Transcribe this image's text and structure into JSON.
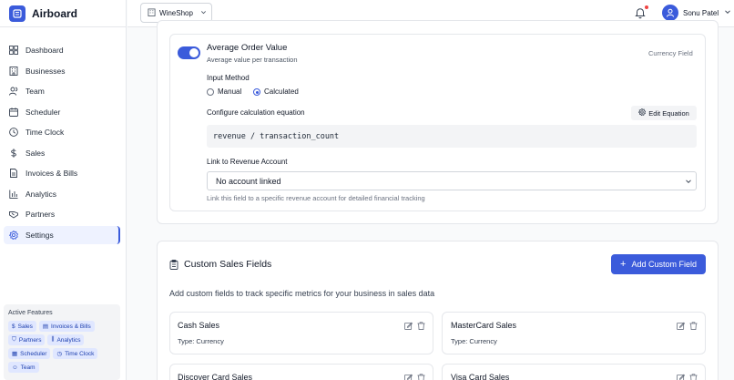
{
  "app": {
    "name": "Airboard"
  },
  "sidebar": {
    "items": [
      {
        "label": "Dashboard",
        "icon": "dashboard-icon"
      },
      {
        "label": "Businesses",
        "icon": "building-icon"
      },
      {
        "label": "Team",
        "icon": "users-icon"
      },
      {
        "label": "Scheduler",
        "icon": "calendar-icon"
      },
      {
        "label": "Time Clock",
        "icon": "clock-icon"
      },
      {
        "label": "Sales",
        "icon": "dollar-icon"
      },
      {
        "label": "Invoices & Bills",
        "icon": "invoice-icon"
      },
      {
        "label": "Analytics",
        "icon": "bar-chart-icon"
      },
      {
        "label": "Partners",
        "icon": "handshake-icon"
      },
      {
        "label": "Settings",
        "icon": "gear-icon",
        "active": true
      }
    ]
  },
  "features": {
    "title": "Active Features",
    "chips": [
      {
        "label": "Sales",
        "icon": "dollar-icon"
      },
      {
        "label": "Invoices & Bills",
        "icon": "invoice-icon"
      },
      {
        "label": "Partners",
        "icon": "handshake-icon"
      },
      {
        "label": "Analytics",
        "icon": "bar-chart-icon"
      },
      {
        "label": "Scheduler",
        "icon": "calendar-icon"
      },
      {
        "label": "Time Clock",
        "icon": "clock-icon"
      },
      {
        "label": "Team",
        "icon": "users-icon"
      }
    ]
  },
  "topbar": {
    "workspace": "WineShop",
    "user_name": "Sonu Patel"
  },
  "field": {
    "title": "Average Order Value",
    "subtitle": "Average value per transaction",
    "type": "Currency Field",
    "enabled": true,
    "input_method_label": "Input Method",
    "option_manual": "Manual",
    "option_calculated": "Calculated",
    "selected_method": "Calculated",
    "equation_label": "Configure calculation equation",
    "edit_equation": "Edit Equation",
    "equation": "revenue / transaction_count",
    "link_label": "Link to Revenue Account",
    "link_value": "No account linked",
    "link_help": "Link this field to a specific revenue account for detailed financial tracking"
  },
  "custom": {
    "title": "Custom Sales Fields",
    "add_button": "Add Custom Field",
    "description": "Add custom fields to track specific metrics for your business in sales data",
    "cards": [
      {
        "name": "Cash Sales",
        "type": "Type: Currency"
      },
      {
        "name": "MasterCard Sales",
        "type": "Type: Currency"
      },
      {
        "name": "Discover Card Sales",
        "type": ""
      },
      {
        "name": "Visa Card Sales",
        "type": ""
      }
    ]
  },
  "colors": {
    "accent": "#3b5bdb",
    "notification": "#ef4444"
  }
}
